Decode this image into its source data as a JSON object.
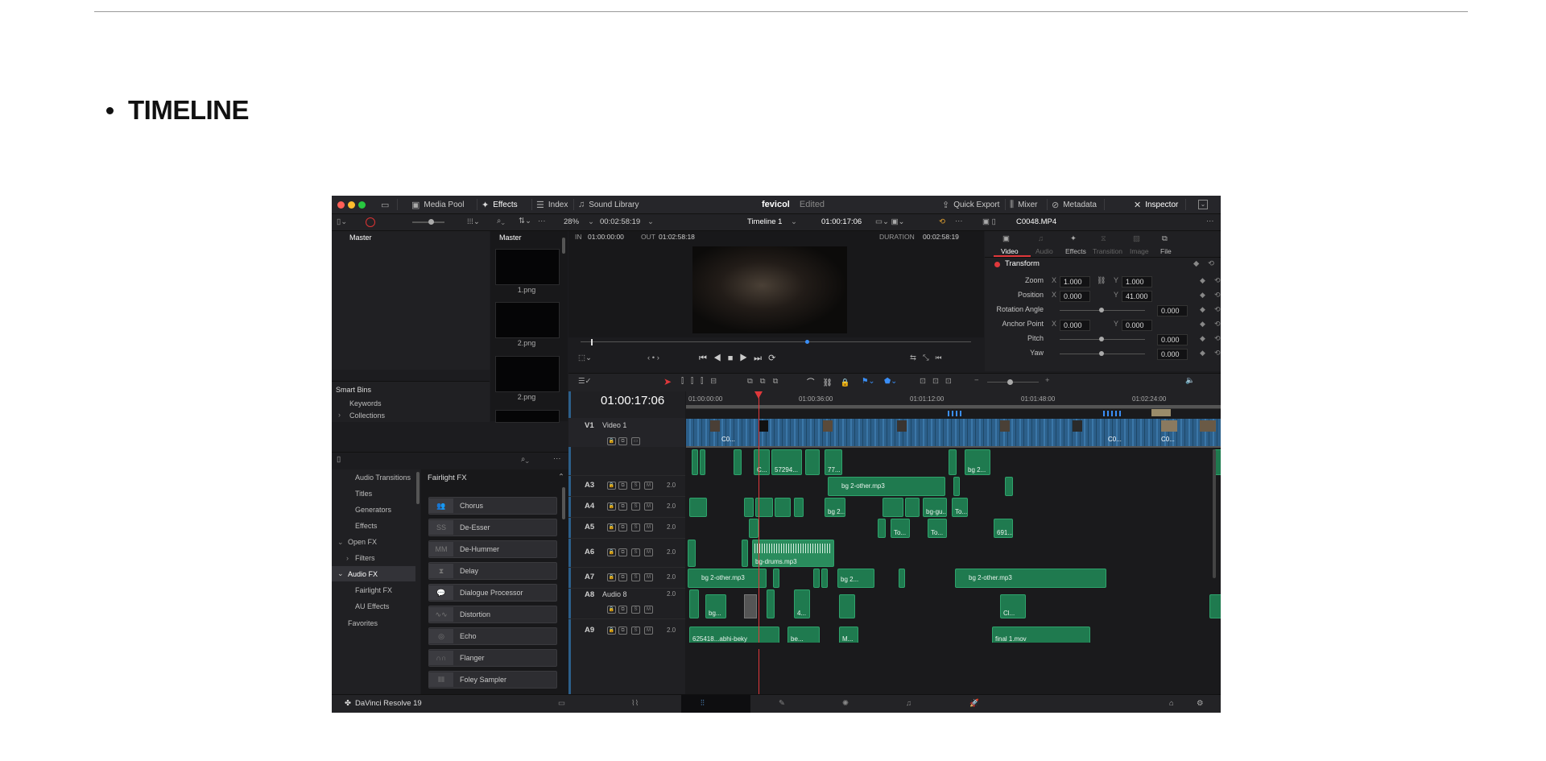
{
  "heading": "TIMELINE",
  "app": {
    "project_name": "fevicol",
    "project_status": "Edited",
    "brand": "DaVinci Resolve 19"
  },
  "topbar": {
    "media_pool": "Media Pool",
    "effects": "Effects",
    "index": "Index",
    "sound_library": "Sound Library",
    "quick_export": "Quick Export",
    "mixer": "Mixer",
    "metadata": "Metadata",
    "inspector": "Inspector"
  },
  "toolbar2": {
    "zoom": "28%",
    "tc_duration": "00:02:58:19",
    "timeline_name": "Timeline 1",
    "tc_current": "01:00:17:06",
    "clip_name": "C0048.MP4"
  },
  "media_pool": {
    "bin_master": "Master",
    "clips_header": "Master",
    "smart_bins": "Smart Bins",
    "keywords": "Keywords",
    "collections": "Collections",
    "thumbs": [
      "1.png",
      "2.png",
      "2.png"
    ]
  },
  "viewer": {
    "in_label": "IN",
    "in_tc": "01:00:00:00",
    "out_label": "OUT",
    "out_tc": "01:02:58:18",
    "duration_label": "DURATION",
    "duration_tc": "00:02:58:19"
  },
  "inspector": {
    "tabs": [
      "Video",
      "Audio",
      "Effects",
      "Transition",
      "Image",
      "File"
    ],
    "section": "Transform",
    "rows": [
      {
        "label": "Zoom",
        "x": "1.000",
        "y": "1.000"
      },
      {
        "label": "Position",
        "x": "0.000",
        "y": "41.000"
      },
      {
        "label": "Rotation Angle",
        "value": "0.000"
      },
      {
        "label": "Anchor Point",
        "x": "0.000",
        "y": "0.000"
      },
      {
        "label": "Pitch",
        "value": "0.000"
      },
      {
        "label": "Yaw",
        "value": "0.000"
      }
    ],
    "x_label": "X",
    "y_label": "Y"
  },
  "effects_panel": {
    "tree": [
      "Audio Transitions",
      "Titles",
      "Generators",
      "Effects",
      "Open FX",
      "Filters",
      "Audio FX",
      "Fairlight FX",
      "AU Effects",
      "Favorites"
    ],
    "list_title": "Fairlight FX",
    "items": [
      "Chorus",
      "De-Esser",
      "De-Hummer",
      "Delay",
      "Dialogue Processor",
      "Distortion",
      "Echo",
      "Flanger",
      "Foley Sampler"
    ]
  },
  "timeline": {
    "timecode": "01:00:17:06",
    "ruler": [
      "01:00:00:00",
      "01:00:36:00",
      "01:01:12:00",
      "01:01:48:00",
      "01:02:24:00"
    ],
    "v1_id": "V1",
    "v1_name": "Video 1",
    "tracks": [
      {
        "id": "A3",
        "ch": "2.0"
      },
      {
        "id": "A4",
        "ch": "2.0"
      },
      {
        "id": "A5",
        "ch": "2.0"
      },
      {
        "id": "A6",
        "ch": "2.0"
      },
      {
        "id": "A7",
        "ch": "2.0"
      },
      {
        "id": "A8",
        "name": "Audio 8",
        "ch": "2.0"
      },
      {
        "id": "A9",
        "ch": "2.0"
      }
    ],
    "clip_labels": {
      "v_c0a": "C0...",
      "v_c0b": "C0...",
      "v_c0c": "C0...",
      "a2_c": "C...",
      "a2_5729": "57294...",
      "a2_77": "77...",
      "a2_bg2": "bg 2...",
      "a3_bg2other": "bg 2-other.mp3",
      "a4_bg2": "bg 2...",
      "a4_bggu": "bg-gu...",
      "a4_to": "To...",
      "a5_to1": "To...",
      "a5_to2": "To...",
      "a5_691": "691...",
      "a6_drums": "bg-drums.mp3",
      "a7_bg2other1": "bg 2-other.mp3",
      "a7_bg2": "bg 2...",
      "a7_bg2other2": "bg 2-other.mp3",
      "a8_bg": "bg...",
      "a8_4": "4...",
      "a8_cl": "Cl...",
      "a9_625": "625418...abhi-beky",
      "a9_be": "be...",
      "a9_m": "M...",
      "a9_final": "final 1.mov"
    }
  }
}
